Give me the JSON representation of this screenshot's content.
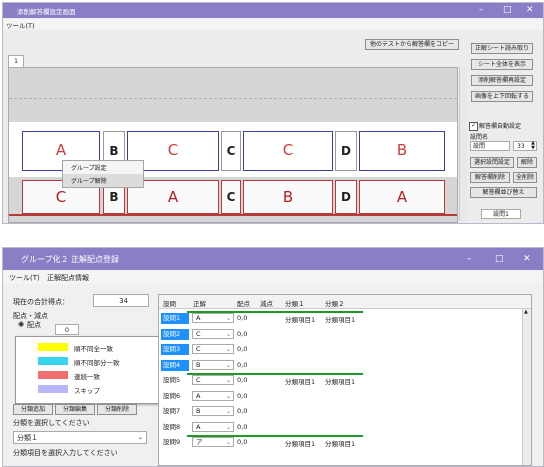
{
  "window1": {
    "title": "添削解答欄設定画面",
    "menu": "ツール(T)",
    "tab_label": "1",
    "copy_button": "他のテストから解答欄をコピー",
    "side_buttons": [
      "正解シート読み取り",
      "シート全体を表示",
      "添削解答欄再設定",
      "画像を上下回転する"
    ],
    "auto_checkbox_label": "解答欄自動設定",
    "question_name_label": "設問名",
    "question_name_value": "設問",
    "question_number": "33",
    "btn_select_set": "選択設問設定",
    "btn_release": "解除",
    "btn_delete_field": "解答欄削除",
    "btn_all_delete": "全削除",
    "btn_reorder": "解答欄並び替え",
    "bottom_select": "設問1",
    "row1": [
      "A",
      "B",
      "C",
      "C",
      "C",
      "D",
      "B"
    ],
    "row2": [
      "C",
      "B",
      "A",
      "C",
      "B",
      "D",
      "A"
    ],
    "context_menu": [
      "グループ設定",
      "グループ解除"
    ]
  },
  "window2": {
    "title": "グループ化２ 正解配点登録",
    "menu": [
      "ツール(T)",
      "正解配点情報"
    ],
    "total_label": "現在の合計得点：",
    "total_value": "34",
    "scoring_label": "配点・減点",
    "radio_label": "配点",
    "radio_value": "0",
    "legend": [
      {
        "label": "順不同全一致",
        "color": "#ffff00"
      },
      {
        "label": "順不同部分一致",
        "color": "#39d3f0"
      },
      {
        "label": "連続一致",
        "color": "#f07070"
      },
      {
        "label": "スキップ",
        "color": "#b8b8f8"
      }
    ],
    "small_buttons": [
      "分類追加",
      "分類編集",
      "分類削除"
    ],
    "select_category_label": "分類を選択してください",
    "category_value": "分類１",
    "input_prompt": "分類項目を選択入力してください",
    "headers": [
      "設問",
      "正解",
      "配点",
      "減点",
      "分類１",
      "分類２"
    ],
    "rows": [
      {
        "q": "設問1",
        "a": "A",
        "score": "0,0",
        "cls": "分類項目1",
        "cls2": "分類項目1",
        "hl": true
      },
      {
        "q": "設問2",
        "a": "C",
        "score": "0,0",
        "cls": "",
        "cls2": "",
        "hl": true
      },
      {
        "q": "設問3",
        "a": "C",
        "score": "0,0",
        "cls": "",
        "cls2": "",
        "hl": true
      },
      {
        "q": "設問4",
        "a": "B",
        "score": "0,0",
        "cls": "",
        "cls2": "",
        "hl": true
      },
      {
        "q": "設問5",
        "a": "C",
        "score": "0,0",
        "cls": "分類項目1",
        "cls2": "分類項目1",
        "hl": false
      },
      {
        "q": "設問6",
        "a": "A",
        "score": "0,0",
        "cls": "",
        "cls2": "",
        "hl": false
      },
      {
        "q": "設問7",
        "a": "B",
        "score": "0,0",
        "cls": "",
        "cls2": "",
        "hl": false
      },
      {
        "q": "設問8",
        "a": "A",
        "score": "0,0",
        "cls": "",
        "cls2": "",
        "hl": false
      },
      {
        "q": "設問9",
        "a": "ア",
        "score": "0,0",
        "cls": "分類項目1",
        "cls2": "分類項目1",
        "hl": false
      }
    ]
  }
}
